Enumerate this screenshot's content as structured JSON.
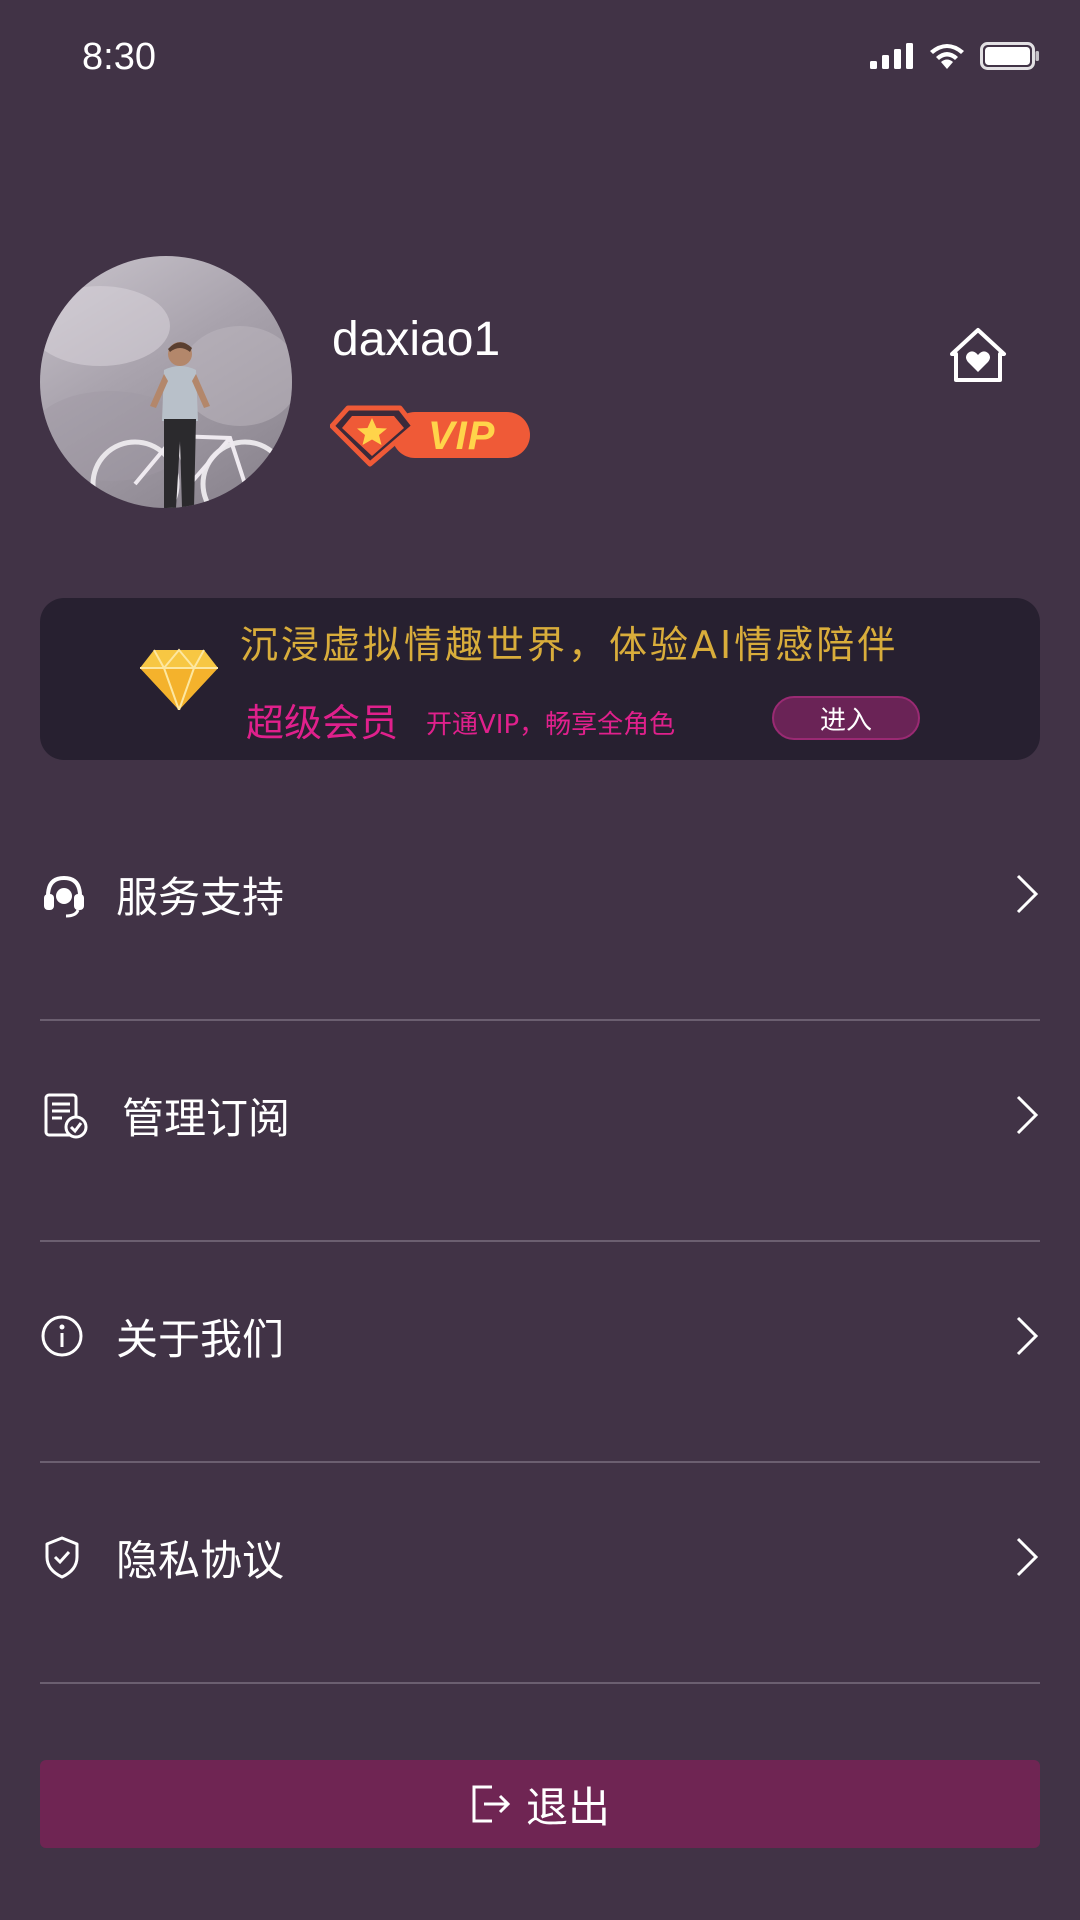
{
  "status_bar": {
    "time": "8:30"
  },
  "profile": {
    "username": "daxiao1",
    "badge_text": "VIP"
  },
  "vip_banner": {
    "title": "沉浸虚拟情趣世界，体验AI情感陪伴",
    "super_member": "超级会员",
    "subtitle": "开通VIP，畅享全角色",
    "enter_label": "进入"
  },
  "menu": {
    "items": [
      {
        "label": "服务支持",
        "icon": "headset-icon"
      },
      {
        "label": "管理订阅",
        "icon": "subscription-document-icon"
      },
      {
        "label": "关于我们",
        "icon": "info-icon"
      },
      {
        "label": "隐私协议",
        "icon": "shield-check-icon"
      }
    ]
  },
  "logout": {
    "label": "退出"
  },
  "colors": {
    "background": "#413346",
    "banner_bg": "#272030",
    "gold": "#d9ad3b",
    "magenta": "#e0208c",
    "logout_bg": "#6f2553"
  }
}
